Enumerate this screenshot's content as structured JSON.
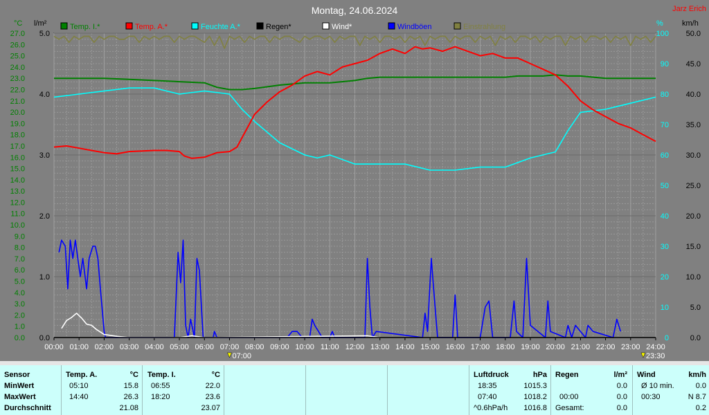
{
  "chart_data": {
    "type": "line",
    "title": "Montag, 24.06.2024",
    "author": "Jarz Erich",
    "x_ticks": [
      "00:00",
      "01:00",
      "02:00",
      "03:00",
      "04:00",
      "05:00",
      "06:00",
      "07:00",
      "08:00",
      "09:00",
      "10:00",
      "11:00",
      "12:00",
      "13:00",
      "14:00",
      "15:00",
      "16:00",
      "17:00",
      "18:00",
      "19:00",
      "20:00",
      "21:00",
      "22:00",
      "23:00",
      "24:00"
    ],
    "sunrise": "07:00",
    "sunset": "23:30",
    "axes": {
      "temp": {
        "unit": "°C",
        "min": 0,
        "max": 27,
        "step": 0.9,
        "ticks": [
          "0.0",
          "0.9",
          "1.8",
          "2.7",
          "3.6",
          "4.5",
          "5.4",
          "6.3",
          "7.2",
          "8.1",
          "9.0",
          "9.9",
          "10.8",
          "11.7",
          "12.6",
          "13.5",
          "14.4",
          "15.3",
          "16.2",
          "17.1",
          "18.0",
          "18.9",
          "19.8",
          "20.7",
          "21.6",
          "22.5",
          "23.4",
          "24.3",
          "25.2",
          "26.1",
          "27.0"
        ],
        "ticks_display": [
          "0.0",
          "1.0",
          "1.9",
          "2.9",
          "3.8",
          "4.8",
          "5.7",
          "6.7",
          "7.6",
          "8.6",
          "9.5",
          "10.5",
          "11.4",
          "12.4",
          "13.3",
          "14.3",
          "15.2",
          "16.2",
          "17.1",
          "18.1",
          "19.0",
          "20.0",
          "20.9",
          "21.9",
          "22.8",
          "23.8",
          "24.7",
          "25.7",
          "26.6",
          "27.6",
          "28.5"
        ],
        "labels": [
          "0.0",
          "1.0",
          "2.0",
          "3.0",
          "4.0",
          "5.0",
          "6.0",
          "7.0",
          "8.0",
          "9.0",
          "10.0",
          "11.0",
          "12.0",
          "13.0",
          "14.0",
          "15.0",
          "16.0",
          "17.0",
          "18.0",
          "19.0",
          "20.0",
          "21.0",
          "22.0",
          "23.0",
          "24.0",
          "25.0",
          "26.0",
          "27.0"
        ]
      },
      "rain": {
        "unit": "l/m²",
        "min": 0,
        "max": 5,
        "labels": [
          "0.0",
          "1.0",
          "2.0",
          "3.0",
          "4.0",
          "5.0"
        ]
      },
      "humidity": {
        "unit": "%",
        "min": 0,
        "max": 100,
        "labels": [
          "0",
          "10",
          "20",
          "30",
          "40",
          "50",
          "60",
          "70",
          "80",
          "90",
          "100"
        ]
      },
      "wind": {
        "unit": "km/h",
        "min": 0,
        "max": 50,
        "labels": [
          "0.0",
          "5.0",
          "10.0",
          "15.0",
          "20.0",
          "25.0",
          "30.0",
          "35.0",
          "40.0",
          "45.0",
          "50.0"
        ]
      }
    },
    "legend": [
      {
        "name": "Temp. I.*",
        "color": "#008000"
      },
      {
        "name": "Temp. A.*",
        "color": "#ff0000"
      },
      {
        "name": "Feuchte A.*",
        "color": "#00ffff"
      },
      {
        "name": "Regen*",
        "color": "#000000"
      },
      {
        "name": "Wind*",
        "color": "#ffffff"
      },
      {
        "name": "Windböen",
        "color": "#0000ff"
      },
      {
        "name": "Einstrahlung",
        "color": "#808040"
      }
    ],
    "series": [
      {
        "key": "temp_in",
        "axis": "temp",
        "color": "#008000",
        "x": [
          0,
          1,
          2,
          3,
          4,
          5,
          6,
          6.5,
          7,
          7.5,
          8,
          9,
          10,
          11,
          12,
          12.5,
          13,
          14,
          15,
          16,
          17,
          18,
          18.5,
          19,
          19.5,
          20,
          20.5,
          21,
          22,
          23,
          24
        ],
        "y": [
          23.0,
          23.0,
          23.0,
          22.9,
          22.8,
          22.7,
          22.6,
          22.2,
          22.0,
          22.0,
          22.1,
          22.4,
          22.6,
          22.6,
          22.8,
          23.0,
          23.1,
          23.1,
          23.1,
          23.1,
          23.1,
          23.1,
          23.2,
          23.2,
          23.2,
          23.3,
          23.2,
          23.2,
          23.0,
          23.0,
          23.0
        ]
      },
      {
        "key": "temp_out",
        "axis": "temp",
        "color": "#ff0000",
        "x": [
          0,
          0.5,
          1,
          1.5,
          2,
          2.5,
          3,
          4,
          4.5,
          5,
          5.2,
          5.5,
          6,
          6.5,
          7,
          7.3,
          8,
          8.5,
          9,
          9.5,
          10,
          10.5,
          11,
          11.5,
          12,
          12.5,
          13,
          13.5,
          14,
          14.4,
          14.7,
          15,
          15.5,
          16,
          16.5,
          17,
          17.5,
          18,
          18.5,
          19,
          19.5,
          20,
          20.5,
          21,
          21.5,
          22,
          22.5,
          23,
          23.5,
          24
        ],
        "y": [
          16.9,
          17.0,
          16.8,
          16.6,
          16.4,
          16.3,
          16.5,
          16.6,
          16.6,
          16.5,
          16.1,
          15.9,
          16.0,
          16.4,
          16.5,
          16.9,
          19.8,
          20.9,
          21.8,
          22.4,
          23.2,
          23.6,
          23.3,
          24.0,
          24.3,
          24.6,
          25.2,
          25.6,
          25.2,
          25.8,
          25.6,
          25.7,
          25.4,
          25.8,
          25.4,
          25.0,
          25.2,
          24.8,
          24.8,
          24.3,
          23.8,
          23.3,
          22.3,
          21.0,
          20.2,
          19.6,
          19.0,
          18.6,
          18.0,
          17.4
        ]
      },
      {
        "key": "humidity",
        "axis": "humidity",
        "color": "#00ffff",
        "x": [
          0,
          1,
          2,
          3,
          4,
          5,
          6,
          7,
          7.5,
          8,
          9,
          10,
          10.5,
          11,
          12,
          13,
          14,
          15,
          16,
          17,
          18,
          19,
          20,
          20.5,
          21,
          22,
          23,
          24
        ],
        "y": [
          79,
          80,
          81,
          82,
          82,
          80,
          81,
          80,
          75,
          71,
          64,
          60,
          59,
          60,
          57,
          57,
          57,
          55,
          55,
          56,
          56,
          59,
          61,
          68,
          74,
          75,
          77,
          79
        ]
      },
      {
        "key": "rain",
        "axis": "rain",
        "color": "#000000",
        "x": [
          0,
          24
        ],
        "y": [
          0,
          0
        ]
      },
      {
        "key": "wind",
        "axis": "wind",
        "color": "#ffffff",
        "x": [
          0.3,
          0.5,
          0.7,
          0.9,
          1.1,
          1.3,
          1.5,
          1.7,
          2.0,
          2.5,
          3.0,
          5.0,
          5.5,
          6.0,
          12.5,
          13.0
        ],
        "y": [
          1.5,
          2.8,
          3.3,
          4.0,
          3.2,
          2.2,
          2.0,
          1.3,
          0.5,
          0.2,
          0,
          0,
          0.3,
          0,
          0.3,
          0
        ]
      },
      {
        "key": "gusts",
        "axis": "wind",
        "color": "#0000ff",
        "x": [
          0.2,
          0.3,
          0.45,
          0.55,
          0.65,
          0.75,
          0.85,
          0.95,
          1.05,
          1.15,
          1.3,
          1.4,
          1.55,
          1.65,
          1.75,
          1.85,
          2.0,
          2.05,
          2.1,
          3.0,
          4.8,
          4.95,
          5.05,
          5.15,
          5.25,
          5.35,
          5.45,
          5.6,
          5.7,
          5.8,
          5.95,
          6.05,
          6.15,
          6.35,
          6.4,
          6.5,
          9.3,
          9.5,
          9.7,
          9.9,
          10.2,
          10.3,
          10.4,
          10.55,
          10.7,
          11.0,
          11.1,
          11.2,
          12.4,
          12.5,
          12.6,
          12.7,
          12.85,
          14.7,
          14.8,
          14.9,
          15.05,
          15.2,
          15.3,
          15.9,
          16.0,
          16.1,
          17.0,
          17.2,
          17.35,
          17.5,
          18.2,
          18.35,
          18.45,
          18.7,
          18.85,
          19.0,
          19.6,
          19.7,
          19.8,
          20.4,
          20.5,
          20.65,
          20.8,
          21.2,
          21.3,
          21.5,
          22.3,
          22.45,
          22.6
        ],
        "y": [
          14,
          16,
          15,
          8,
          16,
          13,
          16,
          13,
          10,
          13,
          8,
          13,
          15,
          15,
          13,
          8,
          1,
          0,
          0,
          0,
          0,
          14,
          9,
          16,
          2,
          0,
          3,
          0,
          13,
          11,
          0,
          0,
          0,
          0,
          1,
          0,
          0,
          1,
          1,
          0,
          0,
          3,
          2,
          1,
          0,
          0,
          1,
          0,
          0,
          13,
          5,
          0,
          1,
          0,
          4,
          1,
          13,
          5,
          0,
          0,
          7,
          0,
          0,
          5,
          6,
          0,
          0,
          6,
          1,
          0,
          13,
          2,
          0,
          6,
          1,
          0,
          2,
          0,
          2,
          0,
          2,
          1,
          0,
          3,
          1
        ]
      },
      {
        "key": "radiation",
        "axis": "humidity",
        "color": "#808040",
        "x": [
          0,
          0.2,
          0.4,
          0.6,
          0.8,
          1,
          1.2,
          1.4,
          1.6,
          1.8,
          2,
          2.2,
          2.4,
          2.6,
          2.8,
          3,
          3.2,
          3.4,
          3.6,
          3.8,
          4,
          4.2,
          4.4,
          4.6,
          4.8,
          5,
          5.2,
          5.4,
          5.6,
          5.8,
          6,
          6.2,
          6.4,
          6.6,
          6.8,
          7,
          7.2,
          7.4,
          7.6,
          7.8,
          8,
          8.2,
          8.4,
          8.6,
          8.8,
          9,
          9.2,
          9.4,
          9.6,
          9.8,
          10,
          10.2,
          10.4,
          10.6,
          10.8,
          11,
          11.2,
          11.4,
          11.6,
          11.8,
          12,
          12.2,
          12.4,
          12.6,
          12.8,
          13,
          13.2,
          13.4,
          13.6,
          13.8,
          14,
          14.2,
          14.4,
          14.6,
          14.8,
          15,
          15.2,
          15.4,
          15.6,
          15.8,
          16,
          16.2,
          16.4,
          16.6,
          16.8,
          17,
          17.2,
          17.4,
          17.6,
          17.8,
          18,
          18.2,
          18.4,
          18.6,
          18.8,
          19,
          19.2,
          19.4,
          19.6,
          19.8,
          20,
          20.2,
          20.4,
          20.6,
          20.8,
          21,
          21.2,
          21.4,
          21.6,
          21.8,
          22,
          22.2,
          22.4,
          22.6,
          22.8,
          23,
          23.2,
          23.4,
          23.6,
          23.8,
          24
        ],
        "y": [
          99,
          98,
          99,
          97,
          99,
          98,
          99,
          99,
          97,
          99,
          98,
          99,
          99,
          98,
          98,
          99,
          99,
          97,
          99,
          98,
          99,
          98,
          99,
          99,
          97,
          99,
          98,
          99,
          99,
          98,
          97,
          99,
          96,
          99,
          95,
          99,
          98,
          99,
          97,
          99,
          98,
          99,
          99,
          97,
          99,
          98,
          99,
          99,
          98,
          97,
          99,
          98,
          99,
          99,
          98,
          99,
          97,
          99,
          98,
          99,
          99,
          96,
          99,
          98,
          99,
          97,
          99,
          99,
          98,
          99,
          97,
          99,
          98,
          99,
          96,
          99,
          98,
          99,
          99,
          97,
          99,
          98,
          99,
          99,
          97,
          99,
          98,
          99,
          96,
          99,
          98,
          99,
          97,
          99,
          99,
          98,
          99,
          97,
          99,
          98,
          99,
          99,
          96,
          99,
          98,
          99,
          97,
          99,
          99,
          98,
          99,
          97,
          99,
          98,
          99,
          96,
          99,
          98,
          99,
          97,
          99
        ]
      }
    ]
  },
  "stats": {
    "sensor": {
      "header": "Sensor",
      "rows": [
        "MinWert",
        "MaxWert",
        "Durchschnitt"
      ]
    },
    "temp_out": {
      "header": "Temp. A.",
      "unit": "°C",
      "min_time": "05:10",
      "min": "15.8",
      "max_time": "14:40",
      "max": "26.3",
      "avg": "21.08"
    },
    "temp_in": {
      "header": "Temp. I.",
      "unit": "°C",
      "min_time": "06:55",
      "min": "22.0",
      "max_time": "18:20",
      "max": "23.6",
      "avg": "23.07"
    },
    "pressure": {
      "header": "Luftdruck",
      "unit": "hPa",
      "min_time": "18:35",
      "min": "1015.3",
      "max_time": "07:40",
      "max": "1018.2",
      "trend_label": "^0.6hPa/h",
      "trend": "1016.8"
    },
    "rain": {
      "header": "Regen",
      "unit": "l/m²",
      "r1_label": "",
      "r1": "0.0",
      "r2_label": "00:00",
      "r2": "0.0",
      "r3_label": "Gesamt:",
      "r3": "0.0"
    },
    "wind": {
      "header": "Wind",
      "unit": "km/h",
      "r1_label": "Ø 10 min.",
      "r1": "0.0",
      "r2_label": "00:30",
      "r2": "N 8.7",
      "r3_label": "",
      "r3": "0.2"
    }
  }
}
